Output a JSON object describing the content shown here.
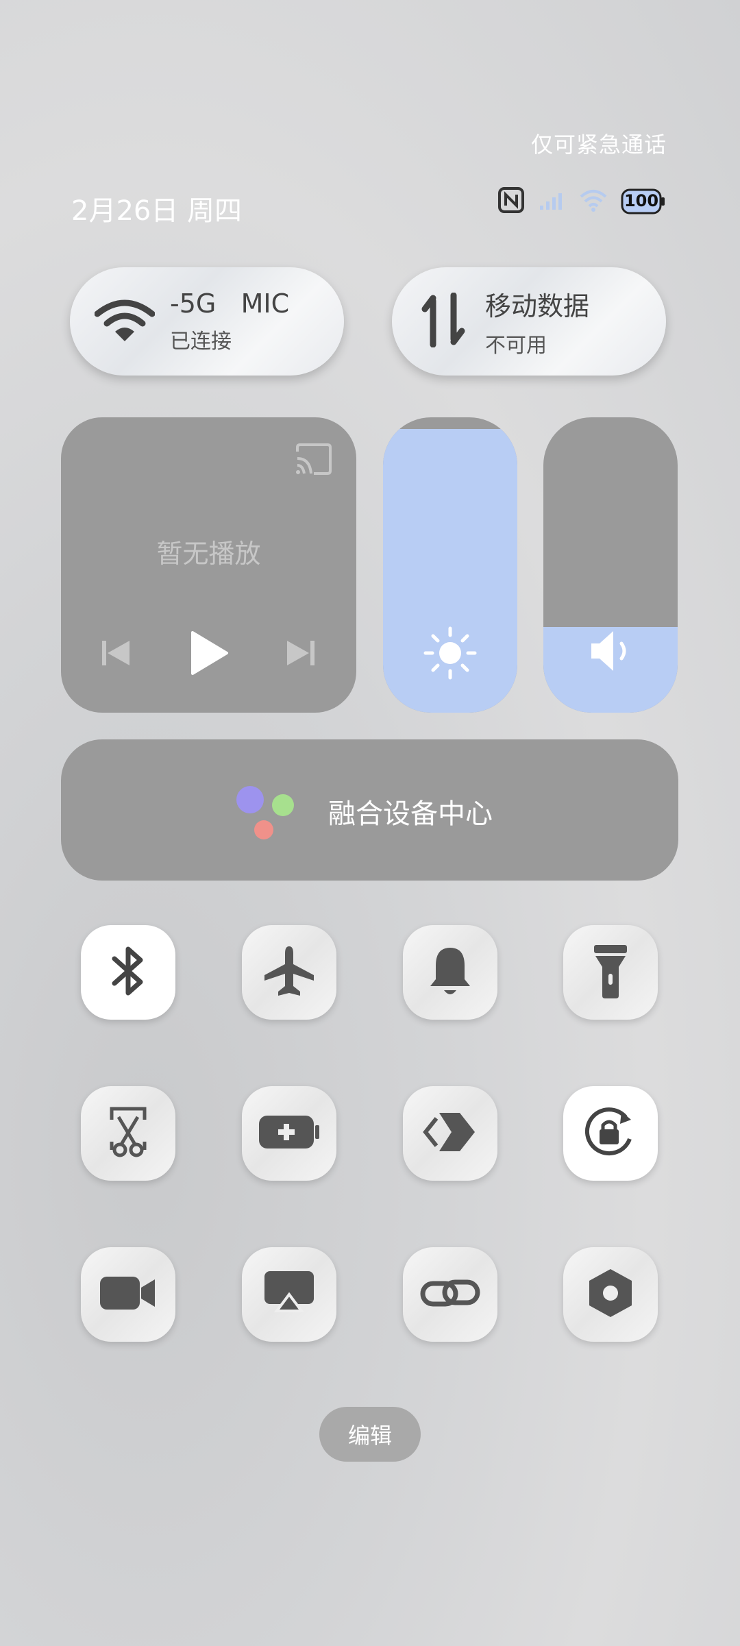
{
  "status_bar": {
    "note": "仅可紧急通话",
    "date": "2月26日 周四",
    "battery": "100",
    "icons": [
      "nfc-icon",
      "signal-icon",
      "wifi-icon",
      "battery-icon"
    ]
  },
  "wifi_card": {
    "title": "-5G   MIC",
    "subtitle": "已连接",
    "icon": "wifi-icon"
  },
  "data_card": {
    "title": "移动数据",
    "subtitle": "不可用",
    "icon": "mobile-data-icon"
  },
  "media": {
    "status": "暂无播放",
    "icons": [
      "cast-icon",
      "previous-icon",
      "play-icon",
      "next-icon"
    ]
  },
  "brightness": {
    "level_fraction": 0.96,
    "icon": "brightness-icon",
    "accent": "#b8cdf4"
  },
  "volume": {
    "level_fraction": 0.29,
    "icon": "volume-icon",
    "accent": "#b8cdf4"
  },
  "fusion_center": {
    "label": "融合设备中心"
  },
  "toggles": [
    {
      "name": "bluetooth",
      "icon": "bluetooth-icon",
      "on": true
    },
    {
      "name": "airplane",
      "icon": "airplane-icon",
      "on": false
    },
    {
      "name": "ring",
      "icon": "bell-icon",
      "on": false
    },
    {
      "name": "flashlight",
      "icon": "flashlight-icon",
      "on": false
    },
    {
      "name": "screenshot",
      "icon": "scissors-icon",
      "on": false
    },
    {
      "name": "power-saving",
      "icon": "battery-plus-icon",
      "on": false
    },
    {
      "name": "link-share",
      "icon": "share-arrow-icon",
      "on": false
    },
    {
      "name": "rotation-lock",
      "icon": "rotation-lock-icon",
      "on": true
    },
    {
      "name": "screen-record",
      "icon": "video-icon",
      "on": false
    },
    {
      "name": "projection",
      "icon": "cast-screen-icon",
      "on": false
    },
    {
      "name": "link",
      "icon": "link-icon",
      "on": false
    },
    {
      "name": "settings",
      "icon": "hexagon-icon",
      "on": false
    }
  ],
  "edit_label": "编辑"
}
